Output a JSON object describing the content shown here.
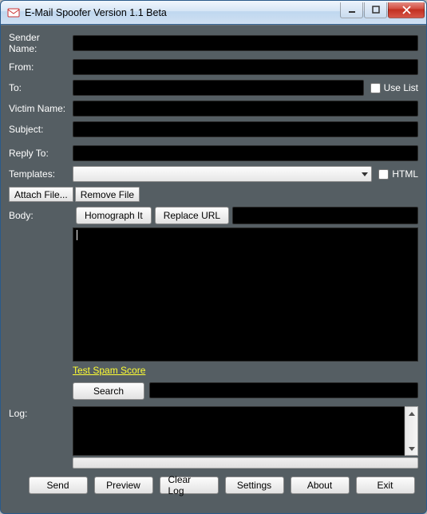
{
  "window": {
    "title": "E-Mail Spoofer Version 1.1 Beta"
  },
  "labels": {
    "sender_name": "Sender Name:",
    "from": "From:",
    "to": "To:",
    "use_list": "Use List",
    "victim_name": "Victim Name:",
    "subject": "Subject:",
    "reply_to": "Reply To:",
    "templates": "Templates:",
    "html": "HTML",
    "body": "Body:",
    "log": "Log:"
  },
  "buttons": {
    "attach_file": "Attach File...",
    "remove_file": "Remove File",
    "homograph_it": "Homograph It",
    "replace_url": "Replace URL",
    "search": "Search",
    "send": "Send",
    "preview": "Preview",
    "clear_log": "Clear Log",
    "settings": "Settings",
    "about": "About",
    "exit": "Exit"
  },
  "links": {
    "test_spam": "Test Spam Score"
  },
  "fields": {
    "sender_name": "",
    "from": "",
    "to": "",
    "victim_name": "",
    "subject": "",
    "reply_to": "",
    "template_selected": "",
    "url": "",
    "body": "",
    "search": "",
    "log": ""
  },
  "checkboxes": {
    "use_list": false,
    "html": false
  }
}
